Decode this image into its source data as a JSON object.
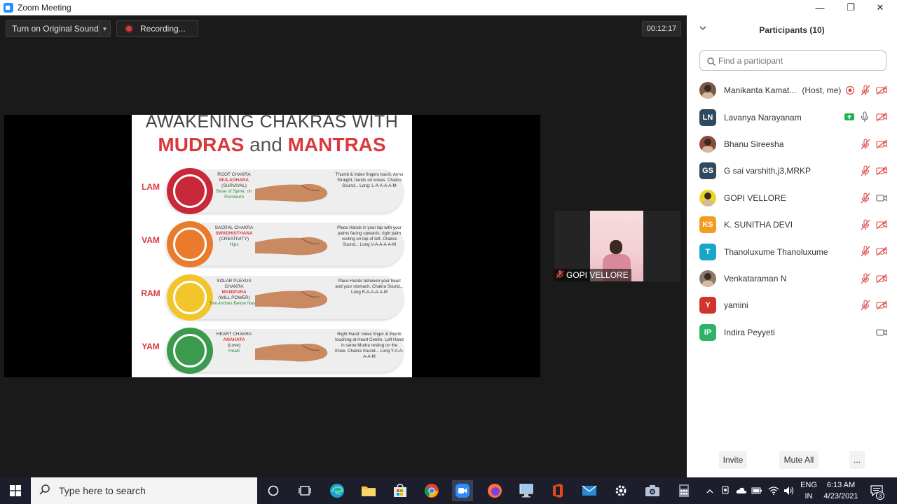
{
  "window": {
    "title": "Zoom Meeting",
    "minimize": "—",
    "restore": "❐",
    "close": "✕"
  },
  "toolbar": {
    "sound_label": "Turn on Original Sound",
    "recording_label": "Recording...",
    "timer": "00:12:17"
  },
  "slide": {
    "title_line1": "AWAKENING CHAKRAS WITH",
    "title_mudras": "MUDRAS",
    "title_and": "and",
    "title_mantras": "MANTRAS",
    "rows": [
      {
        "mantra": "LAM",
        "chakra": "ROOT CHAKRA",
        "sanskrit": "MULADHARA",
        "quality": "(SURVIVAL)",
        "location": "Base of Spine, on Perineum",
        "desc": "Thumb & Index fingers touch. Arms Straight, hands on knees. Chakra Sound... Long: L-A-A-A-A-M",
        "color": "#c8283a"
      },
      {
        "mantra": "VAM",
        "chakra": "SACRAL CHAKRA",
        "sanskrit": "SWADHISTHANA",
        "quality": "(CREATIVITY)",
        "location": "Hips",
        "desc": "Place Hands in your lap with your palms facing upwards, right palm resting on top of left. Chakra Sound... Long V-A-A-A-A-M",
        "color": "#ea7a2c"
      },
      {
        "mantra": "RAM",
        "chakra": "SOLAR PLEXUS CHAKRA",
        "sanskrit": "MANIPURA",
        "quality": "(WILL POWER)",
        "location": "Two-Inches Below Naval",
        "desc": "Place Hands between your heart and your stomach. Chakra Sound... Long R-A-A-A-A-M",
        "color": "#f2c52a"
      },
      {
        "mantra": "YAM",
        "chakra": "HEART CHAKRA",
        "sanskrit": "ANAHATA",
        "quality": "(Love)",
        "location": "Heart",
        "desc": "Right Hand: Index finger & thumb touching at Heart Centre. Left Hand in same Mudra resting on the Knee. Chakra Sound... Long Y-A-A-A-A-M",
        "color": "#3c9a4e"
      }
    ]
  },
  "video": {
    "name": "GOPI VELLORE"
  },
  "participants": {
    "title": "Participants (10)",
    "search_placeholder": "Find a participant",
    "list": [
      {
        "initials": "",
        "name": "Manikanta Kamat...",
        "role": "(Host, me)",
        "avatar_color": "#7a5a44",
        "photo": true,
        "recording": true,
        "mic": "muted",
        "video": "off"
      },
      {
        "initials": "LN",
        "name": "Lavanya Narayanam",
        "role": "",
        "avatar_color": "#2f4a5e",
        "photo": false,
        "share": true,
        "mic": "on",
        "video": "off"
      },
      {
        "initials": "",
        "name": "Bhanu Sireesha",
        "role": "",
        "avatar_color": "#8c4a3a",
        "photo": true,
        "mic": "muted",
        "video": "off"
      },
      {
        "initials": "GS",
        "name": "G sai varshith,j3,MRKP",
        "role": "",
        "avatar_color": "#2f4a5e",
        "photo": false,
        "mic": "muted",
        "video": "off"
      },
      {
        "initials": "",
        "name": "GOPI VELLORE",
        "role": "",
        "avatar_color": "#e8d52a",
        "photo": true,
        "mic": "muted",
        "video": "on"
      },
      {
        "initials": "KS",
        "name": "K. SUNITHA DEVI",
        "role": "",
        "avatar_color": "#f59a23",
        "photo": false,
        "mic": "muted",
        "video": "off"
      },
      {
        "initials": "T",
        "name": "Thanoluxume Thanoluxume",
        "role": "",
        "avatar_color": "#1aa6c8",
        "photo": false,
        "mic": "muted",
        "video": "off"
      },
      {
        "initials": "",
        "name": "Venkataraman N",
        "role": "",
        "avatar_color": "#8a7a6a",
        "photo": true,
        "mic": "muted",
        "video": "off"
      },
      {
        "initials": "Y",
        "name": "yamini",
        "role": "",
        "avatar_color": "#d0342c",
        "photo": false,
        "mic": "muted",
        "video": "off"
      },
      {
        "initials": "IP",
        "name": "Indira Peyyeti",
        "role": "",
        "avatar_color": "#2fb36b",
        "photo": false,
        "mic": "none",
        "video": "on"
      }
    ],
    "invite_label": "Invite",
    "mute_all_label": "Mute All",
    "more_label": "..."
  },
  "taskbar": {
    "search_text": "Type here to search",
    "lang_line1": "ENG",
    "lang_line2": "IN",
    "time": "6:13 AM",
    "date": "4/23/2021",
    "notification_count": "3"
  }
}
